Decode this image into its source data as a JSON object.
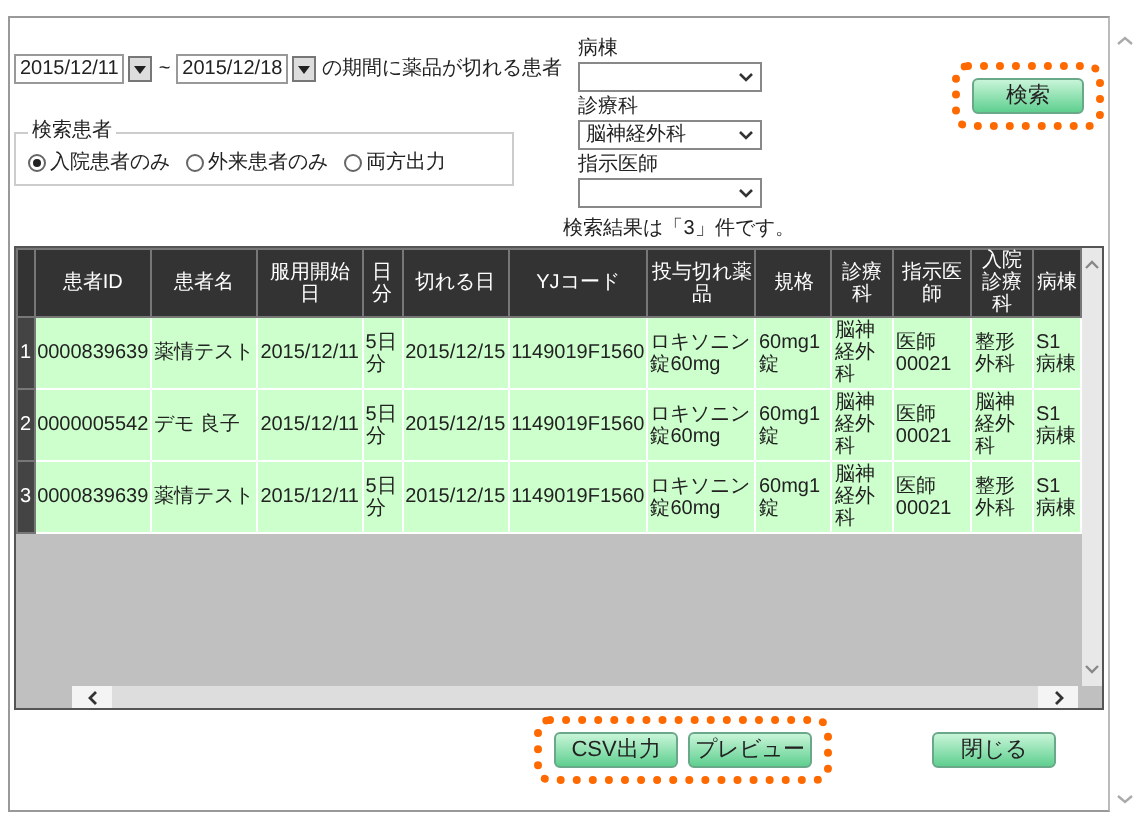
{
  "date_range": {
    "from": "2015/12/11",
    "separator": "~",
    "to": "2015/12/18",
    "suffix": "の期間に薬品が切れる患者"
  },
  "patient_filter": {
    "legend": "検索患者",
    "options": [
      {
        "label": "入院患者のみ",
        "selected": true
      },
      {
        "label": "外来患者のみ",
        "selected": false
      },
      {
        "label": "両方出力",
        "selected": false
      }
    ]
  },
  "filters": [
    {
      "label": "病棟"
    },
    {
      "label": "診療科",
      "value": "脳神経外科"
    },
    {
      "label": "指示医師"
    }
  ],
  "search_button": {
    "label": "検索",
    "highlighted": true
  },
  "result_message": "検索結果は「3」件です。",
  "table": {
    "columns": [
      "患者ID",
      "患者名",
      "服用開始日",
      "日分",
      "切れる日",
      "YJコード",
      "投与切れ薬品",
      "規格",
      "診療科",
      "指示医師",
      "入院診療科",
      "病棟"
    ],
    "rows": [
      {
        "number": "1",
        "cells": [
          "0000839639",
          "薬情テスト",
          "2015/12/11",
          "5日分",
          "2015/12/15",
          "1149019F1560",
          "ロキソニン錠60mg",
          "60mg1錠",
          "脳神経外科",
          "医師00021",
          "整形外科",
          "S1病棟"
        ]
      },
      {
        "number": "2",
        "cells": [
          "0000005542",
          "デモ 良子",
          "2015/12/11",
          "5日分",
          "2015/12/15",
          "1149019F1560",
          "ロキソニン錠60mg",
          "60mg1錠",
          "脳神経外科",
          "医師00021",
          "脳神経外科",
          "S1病棟"
        ]
      },
      {
        "number": "3",
        "cells": [
          "0000839639",
          "薬情テスト",
          "2015/12/11",
          "5日分",
          "2015/12/15",
          "1149019F1560",
          "ロキソニン錠60mg",
          "60mg1錠",
          "脳神経外科",
          "医師00021",
          "整形外科",
          "S1病棟"
        ]
      }
    ]
  },
  "buttons": [
    {
      "label": "CSV出力",
      "highlighted": true
    },
    {
      "label": "プレビュー",
      "highlighted": true
    },
    {
      "label": "閉じる",
      "highlighted": false
    }
  ]
}
